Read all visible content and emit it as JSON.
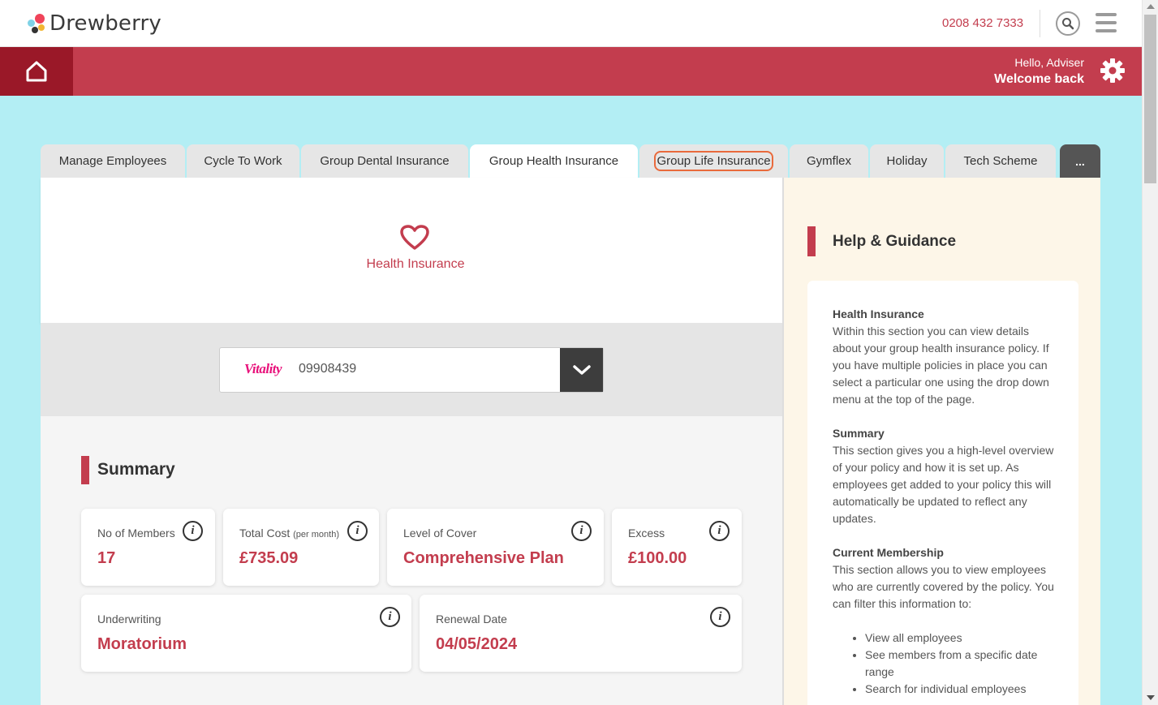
{
  "brand": {
    "name": "Drewberry"
  },
  "header": {
    "phone": "0208 432 7333"
  },
  "user_bar": {
    "greeting": "Hello, Adviser",
    "welcome": "Welcome back"
  },
  "tabs": [
    {
      "label": "Manage Employees"
    },
    {
      "label": "Cycle To Work"
    },
    {
      "label": "Group Dental Insurance"
    },
    {
      "label": "Group Health Insurance",
      "active": true
    },
    {
      "label": "Group Life Insurance",
      "focused": true
    },
    {
      "label": "Gymflex"
    },
    {
      "label": "Holiday"
    },
    {
      "label": "Tech Scheme"
    },
    {
      "label": "..."
    }
  ],
  "hero": {
    "icon": "heart-icon",
    "label": "Health Insurance"
  },
  "policy_select": {
    "provider": "Vitality",
    "policy_number": "09908439"
  },
  "summary": {
    "title": "Summary",
    "cards": [
      {
        "label": "No of Members",
        "value": "17"
      },
      {
        "label": "Total Cost",
        "label_suffix": "(per month)",
        "value": "£735.09"
      },
      {
        "label": "Level of Cover",
        "value": "Comprehensive Plan"
      },
      {
        "label": "Excess",
        "value": "£100.00"
      },
      {
        "label": "Underwriting",
        "value": "Moratorium"
      },
      {
        "label": "Renewal Date",
        "value": "04/05/2024"
      }
    ]
  },
  "help": {
    "title": "Help & Guidance",
    "sections": [
      {
        "heading": "Health Insurance",
        "text": "Within this section you can view details about your group health insurance policy. If you have multiple policies in place you can select a particular one using the drop down menu at the top of the page."
      },
      {
        "heading": "Summary",
        "text": "This section gives you a high-level overview of your policy and how it is set up. As employees get added to your policy this will automatically be updated to reflect any updates."
      },
      {
        "heading": "Current Membership",
        "text": "This section allows you to view employees who are currently covered by the policy. You can filter this information to:"
      }
    ],
    "bullets": [
      "View all employees",
      "See members from a specific date range",
      "Search for individual employees"
    ]
  },
  "colors": {
    "brand_red": "#c33d4e",
    "dark_red": "#9a1828",
    "background": "#b3eef4",
    "help_bg": "#fdf6e8",
    "focus_ring": "#e96a3c"
  }
}
